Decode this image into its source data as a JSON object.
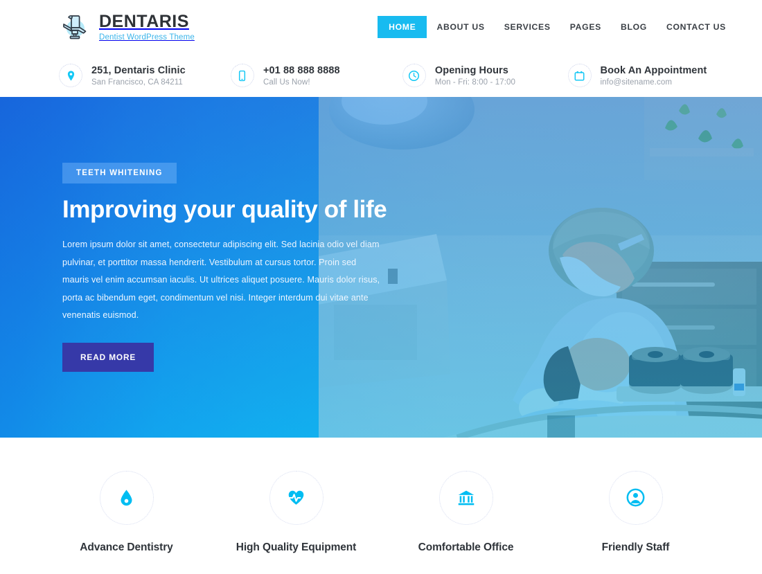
{
  "brand": {
    "name": "DENTARIS",
    "tagline": "Dentist WordPress Theme",
    "logo_icon": "dental-chair-icon",
    "accent": "#18bbf0",
    "tagline_color": "#39b4ea"
  },
  "nav": {
    "items": [
      {
        "label": "HOME",
        "active": true
      },
      {
        "label": "ABOUT US",
        "active": false
      },
      {
        "label": "SERVICES",
        "active": false
      },
      {
        "label": "PAGES",
        "active": false
      },
      {
        "label": "BLOG",
        "active": false
      },
      {
        "label": "CONTACT US",
        "active": false
      }
    ]
  },
  "contact_bar": {
    "items": [
      {
        "icon": "location-pin-icon",
        "title": "251, Dentaris Clinic",
        "sub": "San Francisco, CA 84211"
      },
      {
        "icon": "mobile-phone-icon",
        "title": "+01 88 888 8888",
        "sub": "Call Us Now!"
      },
      {
        "icon": "clock-icon",
        "title": "Opening Hours",
        "sub": "Mon - Fri: 8:00 - 17:00"
      },
      {
        "icon": "calendar-icon",
        "title": "Book An Appointment",
        "sub": "info@sitename.com"
      }
    ]
  },
  "hero": {
    "badge": "TEETH WHITENING",
    "title": "Improving your quality of life",
    "body": "Lorem ipsum dolor sit amet, consectetur adipiscing elit. Sed lacinia odio vel diam pulvinar, et porttitor massa hendrerit. Vestibulum at cursus tortor. Proin sed mauris vel enim accumsan iaculis. Ut ultrices aliquet posuere. Mauris dolor risus, porta ac bibendum eget, condimentum vel nisi. Integer interdum dui vitae ante venenatis euismod.",
    "cta_label": "READ MORE",
    "cta_color": "#3639a8",
    "gradient_from": "#1f6ede",
    "gradient_to": "#00cdf8",
    "image_alt": "dentist treating a patient in a clinic"
  },
  "features": {
    "items": [
      {
        "icon": "water-drop-icon",
        "label": "Advance Dentistry"
      },
      {
        "icon": "heartbeat-icon",
        "label": "High Quality Equipment"
      },
      {
        "icon": "bank-building-icon",
        "label": "Comfortable Office"
      },
      {
        "icon": "user-circle-icon",
        "label": "Friendly Staff"
      }
    ],
    "icon_color": "#00bdf2"
  }
}
